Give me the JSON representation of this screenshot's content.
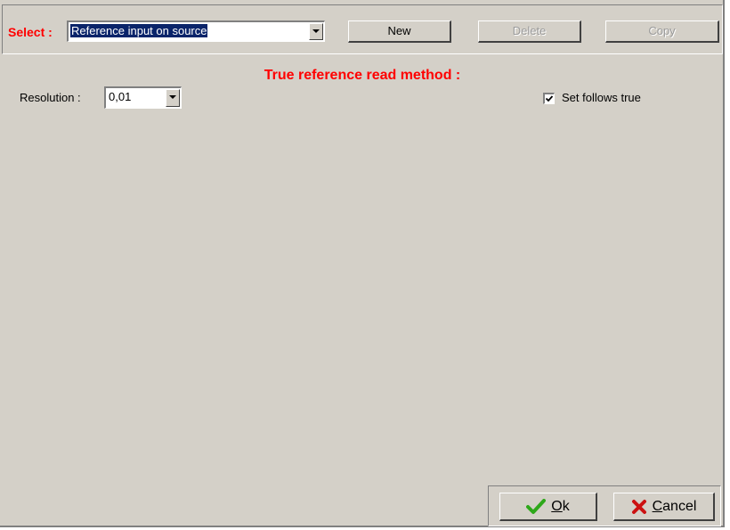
{
  "toolbar": {
    "select_label": "Select :",
    "select_value": "Reference input on source",
    "new_label": "New",
    "delete_label": "Delete",
    "copy_label": "Copy"
  },
  "main": {
    "title": "True reference read method :",
    "resolution_label": "Resolution :",
    "resolution_value": "0,01",
    "set_follows_label": "Set follows true",
    "set_follows_checked": true
  },
  "footer": {
    "ok_mnemonic": "O",
    "ok_rest": "k",
    "cancel_mnemonic": "C",
    "cancel_rest": "ancel"
  },
  "colors": {
    "accent_red": "#ff0000",
    "selection": "#0a246a",
    "panel": "#d4d0c8",
    "ok_check": "#2ea81a",
    "cancel_x": "#cc1111"
  }
}
